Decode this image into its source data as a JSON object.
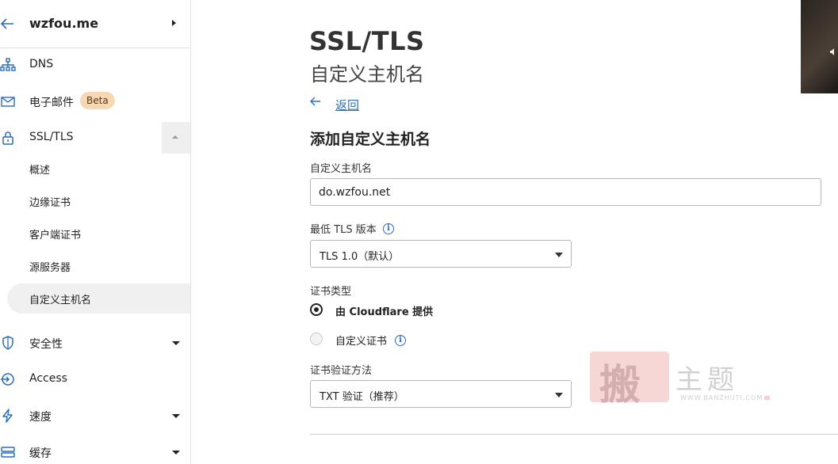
{
  "sidebar": {
    "site_name": "wzfou.me",
    "items": [
      {
        "label": "DNS",
        "icon": "network-icon"
      },
      {
        "label": "电子邮件",
        "icon": "mail-icon",
        "badge": "Beta"
      },
      {
        "label": "SSL/TLS",
        "icon": "lock-icon"
      },
      {
        "label": "安全性",
        "icon": "shield-icon"
      },
      {
        "label": "Access",
        "icon": "access-icon"
      },
      {
        "label": "速度",
        "icon": "lightning-icon"
      },
      {
        "label": "缓存",
        "icon": "cache-icon"
      }
    ],
    "ssl_subitems": [
      "概述",
      "边缘证书",
      "客户端证书",
      "源服务器",
      "自定义主机名"
    ]
  },
  "main": {
    "title": "SSL/TLS",
    "subtitle": "自定义主机名",
    "back_label": "返回",
    "section_title": "添加自定义主机名",
    "hostname_label": "自定义主机名",
    "hostname_value": "do.wzfou.net",
    "min_tls_label": "最低 TLS 版本",
    "min_tls_value": "TLS 1.0（默认）",
    "cert_type_label": "证书类型",
    "cert_type_options": [
      {
        "label": "由 Cloudflare 提供",
        "checked": true
      },
      {
        "label": "自定义证书",
        "checked": false
      }
    ],
    "verify_label": "证书验证方法",
    "verify_value": "TXT 验证（推荐）"
  },
  "watermark": {
    "char": "搬",
    "text": "主题",
    "url": "WWW.BANZHUTI.COM"
  },
  "colors": {
    "accent": "#2c6dbf",
    "badge_bg": "#f7d8b5",
    "active_bg": "#f0f0f0"
  }
}
